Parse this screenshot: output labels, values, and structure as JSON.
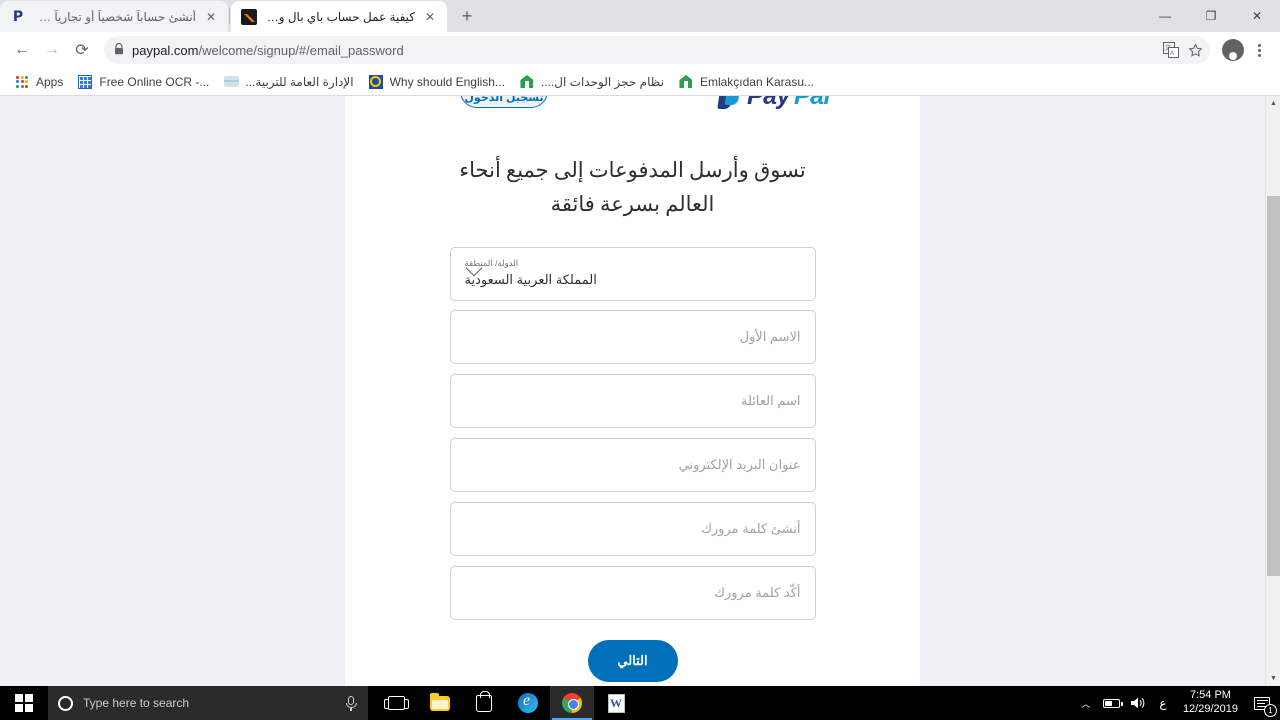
{
  "browser": {
    "tabs": [
      {
        "title": "أنشئ حساباً شخصياً أو تجارياً على ...",
        "favicon": "paypal-favicon",
        "active": false,
        "close_label": "✕"
      },
      {
        "title": "كيفية عمل حساب باي بال وربط بطا...",
        "favicon": "chart-favicon",
        "active": true,
        "close_label": "✕"
      }
    ],
    "new_tab_label": "+",
    "window_controls": {
      "minimize": "—",
      "restore": "❐",
      "close": "✕"
    },
    "nav": {
      "back": "←",
      "forward": "→",
      "reload": "⟳"
    },
    "omnibox": {
      "lock_icon": "lock-icon",
      "url_host": "paypal.com",
      "url_path": "/welcome/signup/#/email_password"
    },
    "toolbar_icons": {
      "translate": "translate-icon",
      "bookmark_star": "★",
      "profile": "profile-avatar",
      "menu": "three-dot-menu"
    },
    "bookmarks": [
      {
        "label": "Apps",
        "icon": "apps-grid-icon"
      },
      {
        "label": "Free Online OCR -...",
        "icon": "blue-grid-icon"
      },
      {
        "label": "الإدارة العامة للتربية...",
        "icon": "wave-icon"
      },
      {
        "label": "Why should English...",
        "icon": "blue-eye-icon"
      },
      {
        "label": "نظام حجز الوحدات ال....",
        "icon": "green-house-icon"
      },
      {
        "label": "Emlakçıdan Karasu...",
        "icon": "green-house-icon"
      }
    ]
  },
  "page": {
    "login_button": "تسجيل الدخول",
    "logo": {
      "pay": "Pay",
      "pal": "Pal"
    },
    "headline": "تسوق وأرسل المدفوعات إلى جميع أنحاء العالم بسرعة فائقة",
    "country": {
      "label": "الدولة/ المنطقة",
      "value": "المملكة العربية السعودية",
      "chevron": "chevron-down-icon"
    },
    "fields": [
      {
        "name": "first-name",
        "placeholder": "الاسم الأول",
        "value": ""
      },
      {
        "name": "last-name",
        "placeholder": "اسم العائلة",
        "value": ""
      },
      {
        "name": "email",
        "placeholder": "عنوان البريد الإلكتروني",
        "value": ""
      },
      {
        "name": "password",
        "placeholder": "أنشئ كلمة مرورك",
        "value": ""
      },
      {
        "name": "confirm-password",
        "placeholder": "أكّد كلمة مرورك",
        "value": ""
      }
    ],
    "submit_button": "التالي",
    "accent_color": "#0070ba"
  },
  "scrollbar": {
    "up_arrow": "▲",
    "down_arrow": "▼"
  },
  "taskbar": {
    "start": "windows-logo",
    "search_placeholder": "Type here to search",
    "mic": "microphone-icon",
    "apps": [
      {
        "name": "task-view",
        "icon": "task-view-icon"
      },
      {
        "name": "file-explorer",
        "icon": "folder-icon"
      },
      {
        "name": "microsoft-store",
        "icon": "store-icon"
      },
      {
        "name": "microsoft-edge",
        "icon": "edge-icon"
      },
      {
        "name": "google-chrome",
        "icon": "chrome-icon"
      },
      {
        "name": "microsoft-word",
        "icon": "word-icon"
      }
    ],
    "tray": {
      "chevron": "︿",
      "battery": "battery-icon",
      "volume": "🔊",
      "language": "ع",
      "time": "7:54 PM",
      "date": "12/29/2019",
      "notifications_count": "1"
    }
  }
}
